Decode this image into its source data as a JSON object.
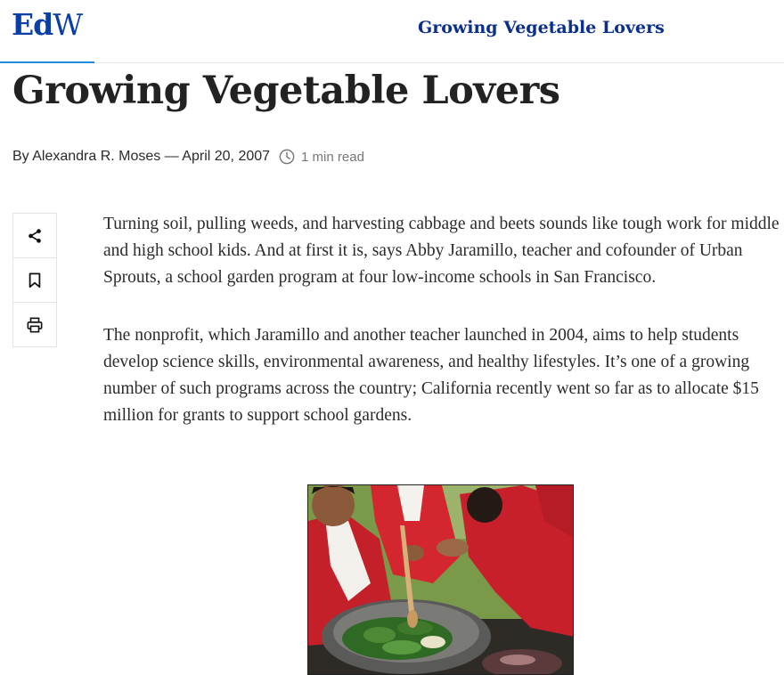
{
  "header": {
    "logo_bold": "Ed",
    "logo_light": "W",
    "title": "Growing Vegetable Lovers"
  },
  "article": {
    "headline": "Growing Vegetable Lovers",
    "byline": "By Alexandra R. Moses — April 20, 2007",
    "read_time": "1 min read",
    "paragraphs": [
      "Turning soil, pulling weeds, and harvesting cabbage and beets sounds like tough work for middle and high school kids. And at first it is, says Abby Jaramillo, teacher and cofounder of Urban Sprouts, a school garden program at four low-income schools in San Francisco.",
      "The nonprofit, which Jaramillo and another teacher launched in 2004, aims to help students develop science skills, environmental awareness, and healthy lifestyles. It’s one of a growing number of such programs across the country; California recently went so far as to allocate $15 million for grants to support school gardens."
    ]
  },
  "share_rail": {
    "items": [
      "share-icon",
      "bookmark-icon",
      "print-icon"
    ]
  },
  "colors": {
    "brand": "#0a3ea8",
    "accent_line": "#1f8ad6"
  }
}
